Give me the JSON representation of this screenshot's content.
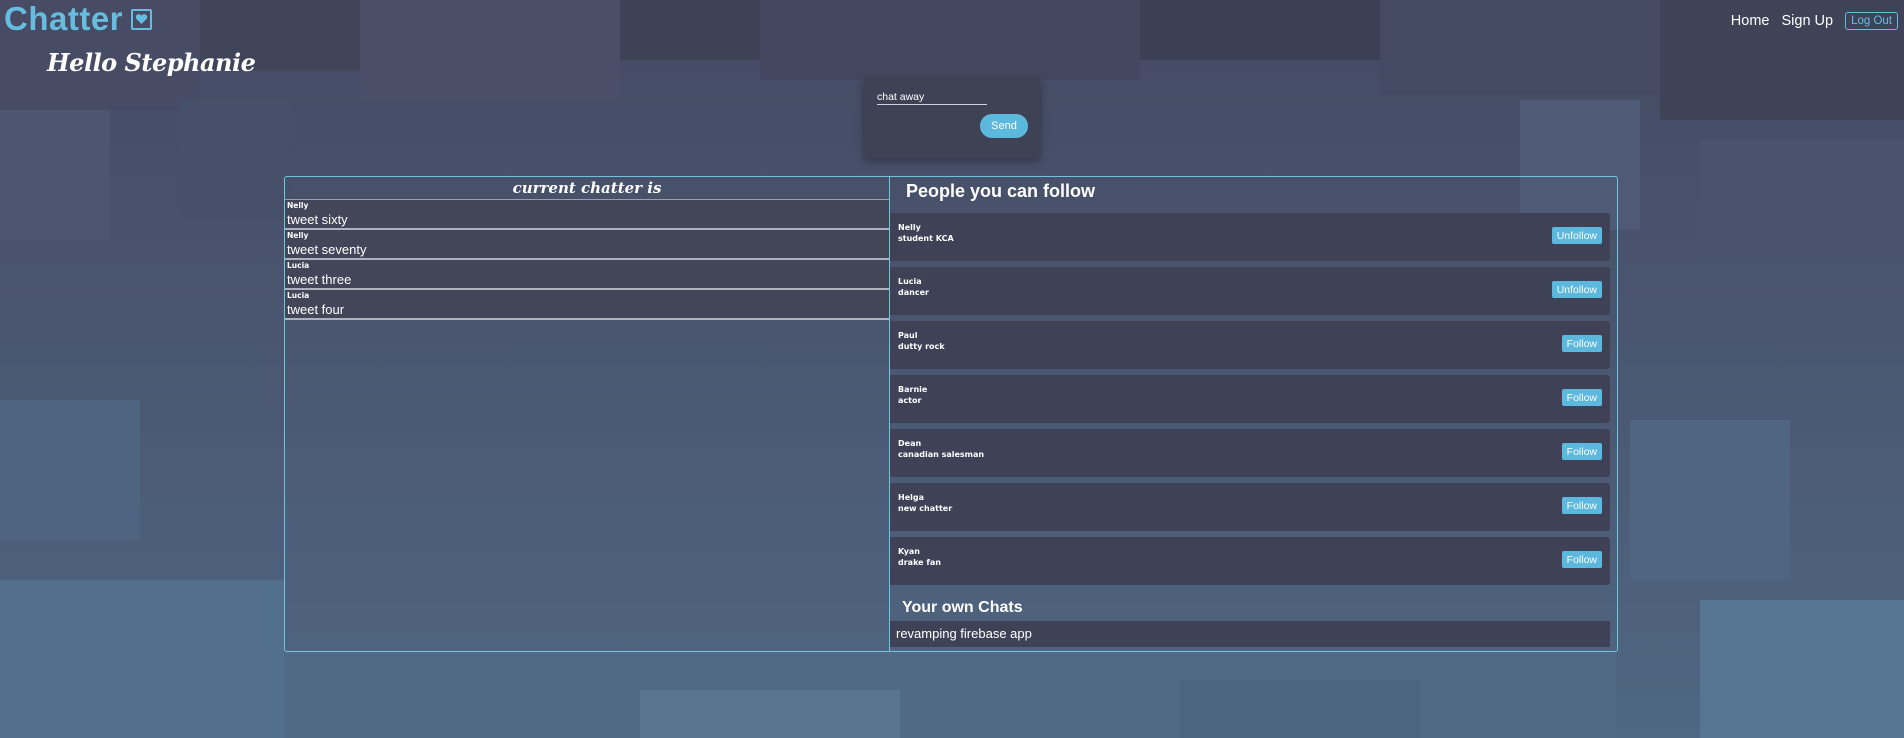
{
  "header": {
    "brand": "Chatter",
    "greeting": "Hello Stephanie",
    "nav": {
      "home": "Home",
      "signup": "Sign Up",
      "logout": "Log Out"
    }
  },
  "compose": {
    "placeholder": "chat away",
    "send_label": "Send"
  },
  "feed": {
    "title": "current chatter is",
    "tweets": [
      {
        "author": "Nelly",
        "text": "tweet sixty"
      },
      {
        "author": "Nelly",
        "text": "tweet seventy"
      },
      {
        "author": "Lucia",
        "text": "tweet three"
      },
      {
        "author": "Lucia",
        "text": "tweet four"
      }
    ]
  },
  "people": {
    "title": "People you can follow",
    "list": [
      {
        "name": "Nelly",
        "bio": "student KCA",
        "action": "Unfollow"
      },
      {
        "name": "Lucia",
        "bio": "dancer",
        "action": "Unfollow"
      },
      {
        "name": "Paul",
        "bio": "dutty rock",
        "action": "Follow"
      },
      {
        "name": "Barnie",
        "bio": "actor",
        "action": "Follow"
      },
      {
        "name": "Dean",
        "bio": "canadian salesman",
        "action": "Follow"
      },
      {
        "name": "Helga",
        "bio": "new chatter",
        "action": "Follow"
      },
      {
        "name": "Kyan",
        "bio": "drake fan",
        "action": "Follow"
      }
    ]
  },
  "own_chats": {
    "title": "Your own Chats",
    "items": [
      "revamping firebase app"
    ]
  },
  "colors": {
    "accent": "#5cb8dc",
    "panel": "#3f4256",
    "border": "#6fc2e0"
  }
}
